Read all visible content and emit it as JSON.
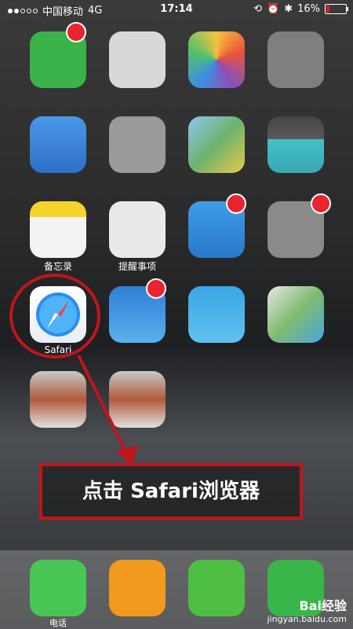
{
  "status_bar": {
    "carrier": "中国移动",
    "network": "4G",
    "time": "17:14",
    "battery_percent": "16%",
    "battery_level": 0.16,
    "signal_bars_filled": 2
  },
  "home": {
    "labels": {
      "row3_app1": "备忘录",
      "row3_app2": "提醒事项",
      "safari": "Safari",
      "dock_app1": "电话"
    }
  },
  "annotation": {
    "callout": "点击 Safari浏览器",
    "accent_color": "#c0151b"
  },
  "watermark": {
    "brand": "Bai经验",
    "url": "jingyan.baidu.com"
  }
}
